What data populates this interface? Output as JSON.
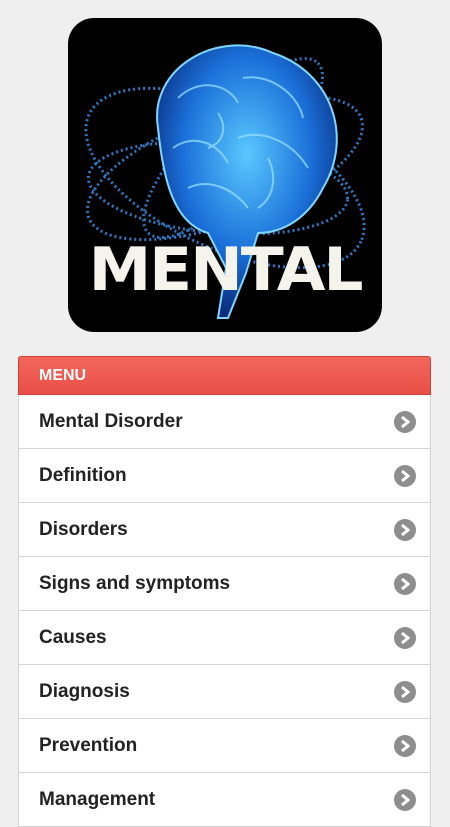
{
  "logo": {
    "text": "MENTAL",
    "icon": "brain-binary-icon"
  },
  "menu": {
    "header": "MENU",
    "items": [
      {
        "label": "Mental Disorder"
      },
      {
        "label": "Definition"
      },
      {
        "label": "Disorders"
      },
      {
        "label": "Signs and symptoms"
      },
      {
        "label": "Causes"
      },
      {
        "label": "Diagnosis"
      },
      {
        "label": "Prevention"
      },
      {
        "label": "Management"
      }
    ]
  },
  "colors": {
    "accent": "#ee5a50",
    "chevron": "#8e8e8e",
    "background": "#efefef"
  }
}
